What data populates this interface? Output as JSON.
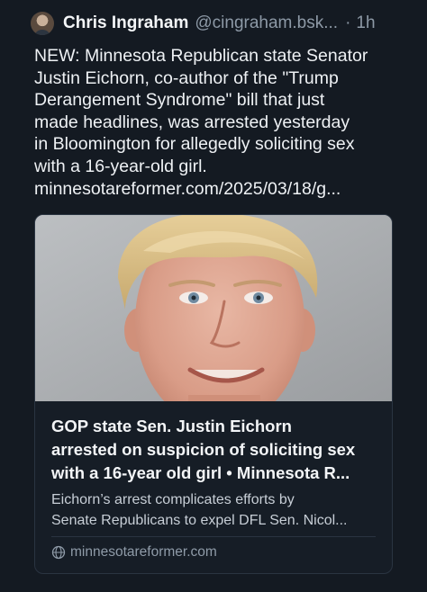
{
  "post": {
    "author_name": "Chris Ingraham",
    "handle": "@cingraham.bsk...",
    "separator": "·",
    "time": "1h",
    "text_lines": [
      "NEW: Minnesota Republican state Senator",
      "Justin Eichorn, co-author of the \"Trump",
      "Derangement Syndrome\" bill that just",
      "made headlines, was arrested yesterday",
      "in Bloomington for allegedly soliciting sex",
      "with a 16-year-old girl.",
      "minnesotareformer.com/2025/03/18/g..."
    ]
  },
  "link_card": {
    "title_lines": [
      "GOP state Sen. Justin Eichorn",
      "arrested on suspicion of soliciting sex",
      "with a 16-year old girl • Minnesota R..."
    ],
    "description_lines": [
      "Eichorn’s arrest complicates efforts by",
      "Senate Republicans to expel DFL Sen. Nicol..."
    ],
    "domain": "minnesotareformer.com",
    "domain_icon": "globe-icon"
  },
  "colors": {
    "background": "#141a22",
    "text": "#eef1f4",
    "muted": "#8d99a6",
    "card_border": "#2a3441"
  }
}
